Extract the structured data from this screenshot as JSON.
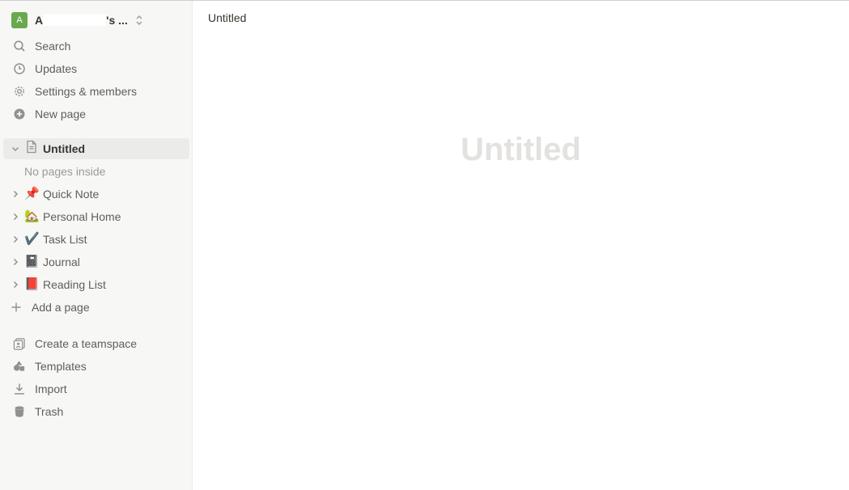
{
  "workspace": {
    "avatar_letter": "A",
    "name_start": "A",
    "name_end": "'s ..."
  },
  "nav": {
    "search": "Search",
    "updates": "Updates",
    "settings": "Settings & members",
    "new_page": "New page"
  },
  "pages": {
    "current": "Untitled",
    "empty_text": "No pages inside",
    "items": [
      {
        "emoji": "📌",
        "label": "Quick Note"
      },
      {
        "emoji": "🏡",
        "label": "Personal Home"
      },
      {
        "emoji": "✔️",
        "label": "Task List"
      },
      {
        "emoji": "📓",
        "label": "Journal"
      },
      {
        "emoji": "📕",
        "label": "Reading List"
      }
    ],
    "add_page": "Add a page"
  },
  "bottom": {
    "teamspace": "Create a teamspace",
    "templates": "Templates",
    "import": "Import",
    "trash": "Trash"
  },
  "main": {
    "breadcrumb": "Untitled",
    "title_placeholder": "Untitled"
  }
}
